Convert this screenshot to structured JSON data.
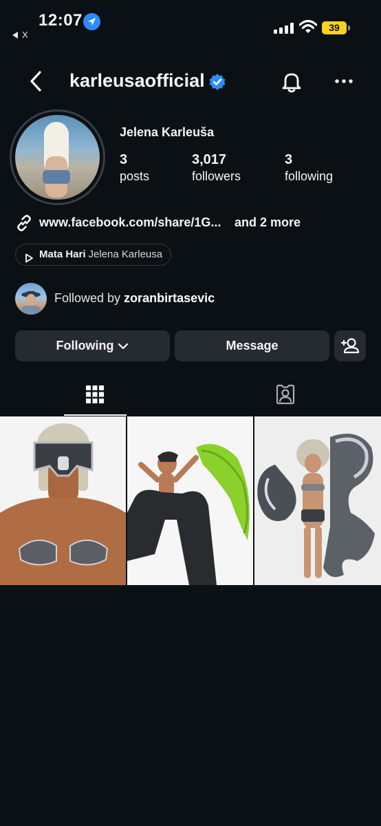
{
  "status_bar": {
    "time": "12:07",
    "back_app_label": "X",
    "battery": "39",
    "battery_color": "#f7d21e",
    "location_color": "#2d8cff"
  },
  "header": {
    "username": "karleusaofficial",
    "verified_color": "#2d8cff",
    "icons": [
      "back-icon",
      "verified-badge-icon",
      "bell-icon",
      "more-icon"
    ]
  },
  "profile": {
    "display_name": "Jelena Karleuša",
    "stats": [
      {
        "value": "3",
        "label": "posts"
      },
      {
        "value": "3,017",
        "label": "followers"
      },
      {
        "value": "3",
        "label": "following"
      }
    ],
    "link_text": "www.facebook.com/share/1G...",
    "link_more": "and 2 more",
    "music": {
      "song": "Mata Hari",
      "artist": "Jelena Karleusa"
    },
    "followed_by_prefix": "Followed by",
    "followed_by_user": "zoranbirtasevic"
  },
  "buttons": {
    "following": "Following",
    "message": "Message"
  },
  "tabs": [
    {
      "name": "grid",
      "icon": "grid-icon",
      "active": true
    },
    {
      "name": "tagged",
      "icon": "tagged-person-icon",
      "active": false
    }
  ],
  "posts": [
    {
      "description": "post-1"
    },
    {
      "description": "post-2"
    },
    {
      "description": "post-3"
    }
  ]
}
